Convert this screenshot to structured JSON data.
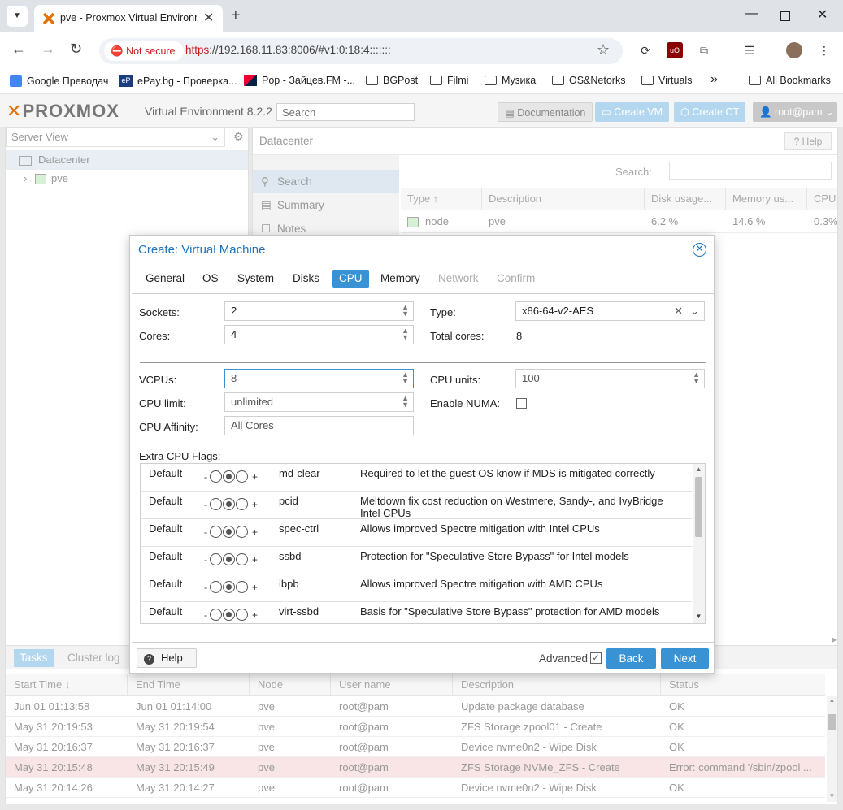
{
  "browser": {
    "tab_title": "pve - Proxmox Virtual Environment",
    "url_scheme": "https",
    "url_rest": "://192.168.11.83:8006/#v1:0:18:4:::::::",
    "not_secure": "Not secure",
    "bookmarks": [
      {
        "label": "Google Преводач",
        "icon": "google-translate-icon"
      },
      {
        "label": "ePay.bg - Проверка...",
        "icon": "epay-icon"
      },
      {
        "label": "Pop - Зайцев.FM -...",
        "icon": "zaycev-icon"
      },
      {
        "label": "BGPost",
        "icon": "folder-icon"
      },
      {
        "label": "Filmi",
        "icon": "folder-icon"
      },
      {
        "label": "Музика",
        "icon": "folder-icon"
      },
      {
        "label": "OS&Netorks",
        "icon": "folder-icon"
      },
      {
        "label": "Virtuals",
        "icon": "folder-icon"
      }
    ],
    "all_bookmarks": "All Bookmarks"
  },
  "pve": {
    "logo": "PROXMOX",
    "version": "Virtual Environment 8.2.2",
    "search_placeholder": "Search",
    "documentation": "Documentation",
    "create_vm": "Create VM",
    "create_ct": "Create CT",
    "user": "root@pam",
    "server_view": "Server View",
    "tree": {
      "datacenter": "Datacenter",
      "node": "pve"
    },
    "content_title": "Datacenter",
    "help": "Help",
    "nav": [
      "Search",
      "Summary",
      "Notes"
    ],
    "search_label": "Search:",
    "grid_headers": [
      "Type ↑",
      "Description",
      "Disk usage...",
      "Memory us...",
      "CPU"
    ],
    "grid_row": {
      "type": "node",
      "description": "pve",
      "disk": "6.2 %",
      "memory": "14.6 %",
      "cpu": "0.3%"
    },
    "tasks_tab": "Tasks",
    "cluster_tab": "Cluster log",
    "tasks_headers": [
      "Start Time ↓",
      "End Time",
      "Node",
      "User name",
      "Description",
      "Status"
    ],
    "tasks": [
      {
        "start": "Jun 01 01:13:58",
        "end": "Jun 01 01:14:00",
        "node": "pve",
        "user": "root@pam",
        "desc": "Update package database",
        "status": "OK"
      },
      {
        "start": "May 31 20:19:53",
        "end": "May 31 20:19:54",
        "node": "pve",
        "user": "root@pam",
        "desc": "ZFS Storage zpool01 - Create",
        "status": "OK"
      },
      {
        "start": "May 31 20:16:37",
        "end": "May 31 20:16:37",
        "node": "pve",
        "user": "root@pam",
        "desc": "Device nvme0n2 - Wipe Disk",
        "status": "OK"
      },
      {
        "start": "May 31 20:15:48",
        "end": "May 31 20:15:49",
        "node": "pve",
        "user": "root@pam",
        "desc": "ZFS Storage NVMe_ZFS - Create",
        "status": "Error: command '/sbin/zpool ..."
      },
      {
        "start": "May 31 20:14:26",
        "end": "May 31 20:14:27",
        "node": "pve",
        "user": "root@pam",
        "desc": "Device nvme0n2 - Wipe Disk",
        "status": "OK"
      }
    ]
  },
  "dialog": {
    "title": "Create: Virtual Machine",
    "tabs": [
      {
        "label": "General",
        "state": "normal"
      },
      {
        "label": "OS",
        "state": "normal"
      },
      {
        "label": "System",
        "state": "normal"
      },
      {
        "label": "Disks",
        "state": "normal"
      },
      {
        "label": "CPU",
        "state": "active"
      },
      {
        "label": "Memory",
        "state": "normal"
      },
      {
        "label": "Network",
        "state": "disabled"
      },
      {
        "label": "Confirm",
        "state": "disabled"
      }
    ],
    "sockets_label": "Sockets:",
    "sockets": "2",
    "cores_label": "Cores:",
    "cores": "4",
    "type_label": "Type:",
    "type": "x86-64-v2-AES",
    "total_cores_label": "Total cores:",
    "total_cores": "8",
    "vcpus_label": "VCPUs:",
    "vcpus": "8",
    "cpu_units_label": "CPU units:",
    "cpu_units": "100",
    "cpu_limit_label": "CPU limit:",
    "cpu_limit": "unlimited",
    "numa_label": "Enable NUMA:",
    "numa_checked": false,
    "affinity_label": "CPU Affinity:",
    "affinity": "All Cores",
    "flags_label": "Extra CPU Flags:",
    "flags": [
      {
        "state": "Default",
        "name": "md-clear",
        "desc": "Required to let the guest OS know if MDS is mitigated correctly"
      },
      {
        "state": "Default",
        "name": "pcid",
        "desc": "Meltdown fix cost reduction on Westmere, Sandy-, and IvyBridge Intel CPUs"
      },
      {
        "state": "Default",
        "name": "spec-ctrl",
        "desc": "Allows improved Spectre mitigation with Intel CPUs"
      },
      {
        "state": "Default",
        "name": "ssbd",
        "desc": "Protection for \"Speculative Store Bypass\" for Intel models"
      },
      {
        "state": "Default",
        "name": "ibpb",
        "desc": "Allows improved Spectre mitigation with AMD CPUs"
      },
      {
        "state": "Default",
        "name": "virt-ssbd",
        "desc": "Basis for \"Speculative Store Bypass\" protection for AMD models"
      }
    ],
    "minus": "-",
    "plus": "+",
    "help": "Help",
    "advanced": "Advanced",
    "advanced_checked": true,
    "back": "Back",
    "next": "Next"
  },
  "colors": {
    "accent": "#3892d4",
    "title_blue": "#1e74c0",
    "brand_orange": "#e57000",
    "error_row": "#f9e5e5"
  }
}
